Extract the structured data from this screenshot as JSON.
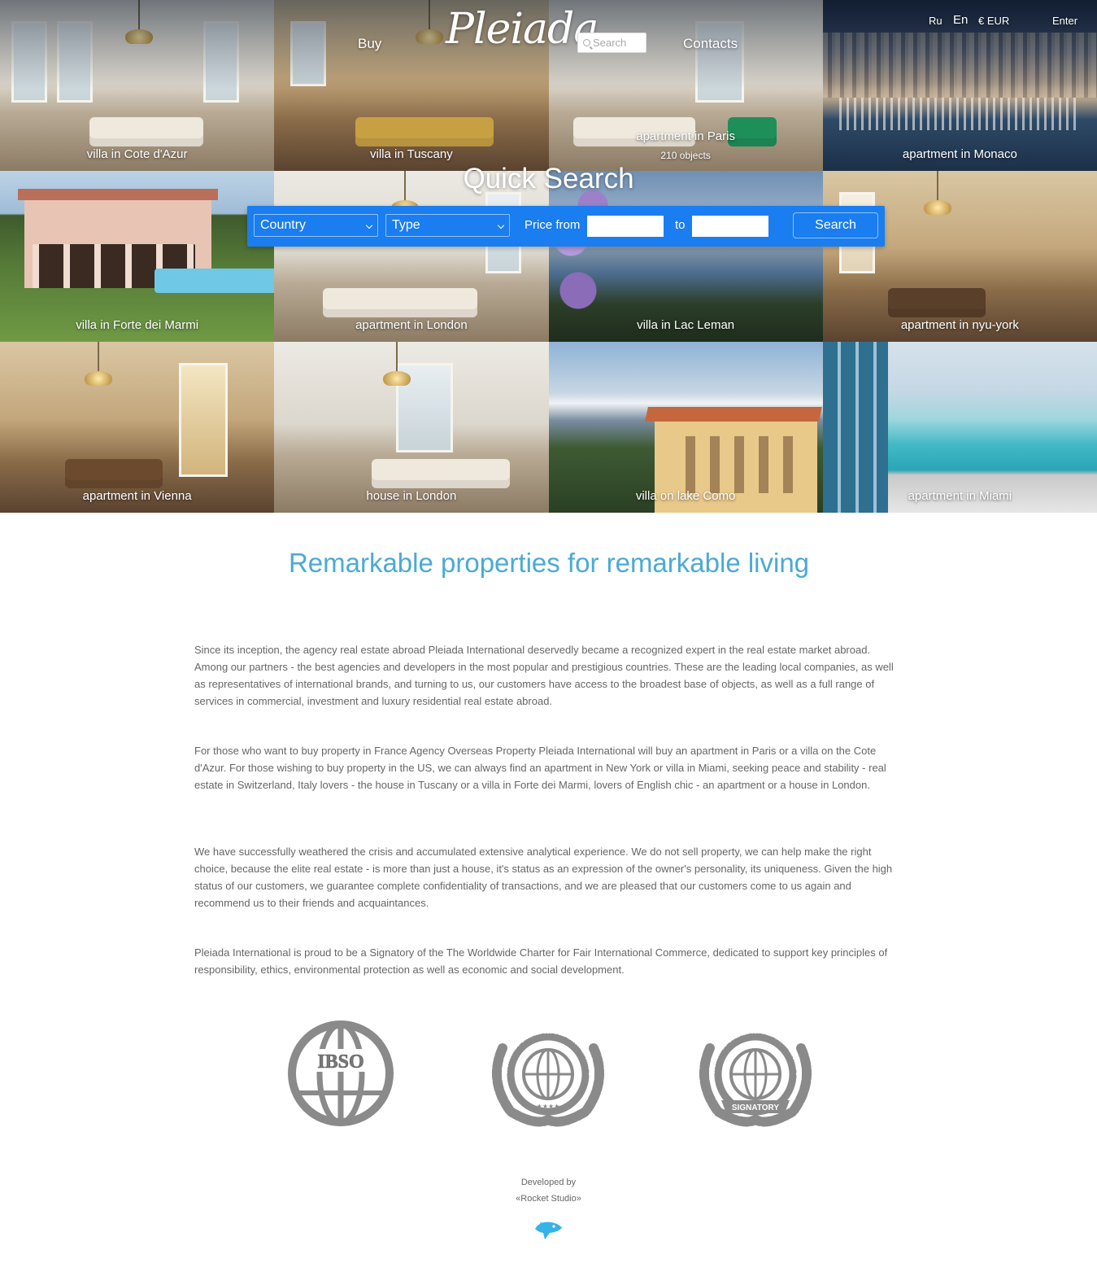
{
  "header": {
    "nav_buy": "Buy",
    "logo_text": "Pleiada",
    "search_placeholder": "Search",
    "nav_contacts": "Contacts",
    "lang_ru": "Ru",
    "lang_en": "En",
    "currency": "€ EUR",
    "enter": "Enter"
  },
  "tiles": [
    {
      "caption": "villa in Cote d'Azur"
    },
    {
      "caption": "villa in Tuscany"
    },
    {
      "caption": "apartment in Paris",
      "count": "210 objects"
    },
    {
      "caption": "apartment in Monaco"
    },
    {
      "caption": "villa in Forte dei Marmi"
    },
    {
      "caption": "apartment in London"
    },
    {
      "caption": "villa in Lac Leman"
    },
    {
      "caption": "apartment in nyu-york"
    },
    {
      "caption": "apartment in Vienna"
    },
    {
      "caption": "house in London"
    },
    {
      "caption": "villa on lake Como"
    },
    {
      "caption": "apartment in Miami"
    }
  ],
  "quick_search": {
    "title": "Quick Search",
    "country": "Country",
    "type": "Type",
    "price_from": "Price from",
    "to": "to",
    "button": "Search"
  },
  "content": {
    "headline": "Remarkable properties for remarkable living",
    "paragraphs": [
      "Since its inception, the agency real estate abroad Pleiada International deservedly became a recognized expert in the real estate market abroad. Among our partners - the best agencies and developers in the most popular and prestigious countries. These are the leading local companies, as well as representatives of international brands, and turning to us, our customers have access to the broadest base of objects, as well as a full range of services in commercial, investment and luxury residential real estate abroad.",
      "For those who want to buy property in France Agency Overseas Property Pleiada International will buy an apartment in Paris or a villa on the Cote d'Azur. For those wishing to buy property in the US, we can always find an apartment in New York or villa in Miami, seeking peace and stability - real estate in Switzerland, Italy lovers - the house in Tuscany or a villa in Forte dei Marmi, lovers of English chic - an apartment or a house in London.",
      "We have successfully weathered the crisis and accumulated extensive analytical experience. We do not sell property, we can help make the right choice, because the elite real estate - is more than just a house, it's status as an expression of the owner's personality, its uniqueness. Given the high status of our customers, we guarantee complete confidentiality of transactions, and we are pleased that our customers come to us again and recommend us to their friends and acquaintances.",
      "Pleiada International is proud to be a Signatory of the The Worldwide Charter for Fair International Commerce, dedicated to support key principles of responsibility, ethics, environmental protection as well as economic and social development."
    ]
  },
  "badges": {
    "ibso": "IBSO",
    "charter_ring": "Worldwide Charter for Fair International Commerce",
    "signatory": "SIGNATORY"
  },
  "footer": {
    "developed_by": "Developed by",
    "studio": "«Rocket Studio»"
  },
  "colors": {
    "accent_blue": "#1a7df0",
    "headline_blue": "#4aaad6",
    "badge_gray": "#8a8a8a"
  }
}
